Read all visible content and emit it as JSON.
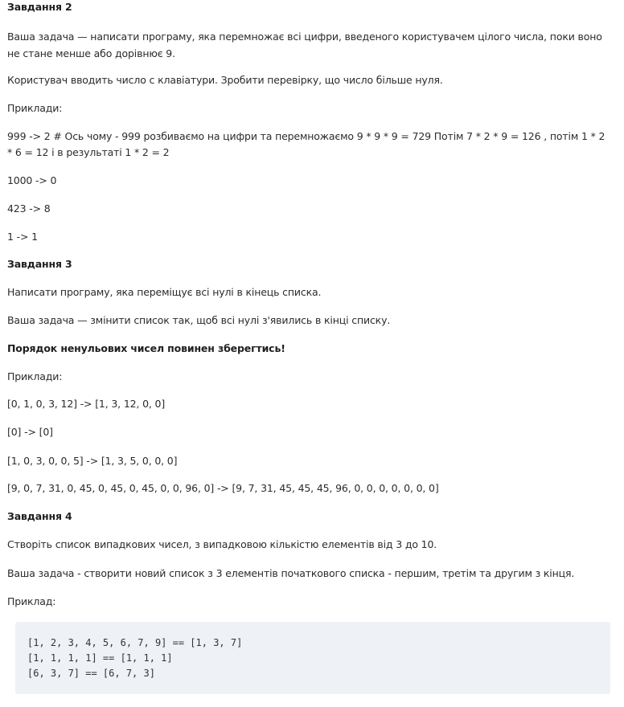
{
  "task2": {
    "heading": "Завдання 2",
    "desc": "Ваша задача — написати програму, яка перемножає всі цифри, введеного користувачем цілого числа, поки воно не стане менше або дорівнює 9.",
    "input_note": "Користувач вводить число с клавіатури. Зробити перевірку, що число більше нуля.",
    "examples_label": "Приклади:",
    "examples": [
      "999 -> 2 # Ось чому - 999 розбиваємо на цифри та перемножаємо 9 * 9 * 9 = 729 Потім 7 * 2 * 9 = 126 , потім 1 * 2 * 6 = 12 і в результаті 1 * 2 = 2",
      "1000 -> 0",
      "423 -> 8",
      "1 -> 1"
    ]
  },
  "task3": {
    "heading": "Завдання 3",
    "desc": "Написати програму, яка переміщує всі нулі в кінець списка.",
    "goal": "Ваша задача — змінити список так, щоб всі нулі з'явились в кінці списку.",
    "note": "Порядок ненульових чисел повинен зберегтись!",
    "examples_label": "Приклади:",
    "examples": [
      "[0, 1, 0, 3, 12] -> [1, 3, 12, 0, 0]",
      "[0] -> [0]",
      "[1, 0, 3, 0, 0, 5] -> [1, 3, 5, 0, 0, 0]",
      "[9, 0, 7, 31, 0, 45, 0, 45, 0, 45, 0, 0, 96, 0] -> [9, 7, 31, 45, 45, 45, 96, 0, 0, 0, 0, 0, 0, 0]"
    ]
  },
  "task4": {
    "heading": "Завдання 4",
    "desc": "Створіть список випадкових чисел, з випадковою кількістю елементів від 3 до 10.",
    "goal": "Ваша задача - створити новий список з 3 елементів початкового списка - першим, третім та другим з кінця.",
    "example_label": "Приклад:",
    "code": [
      "[1, 2, 3, 4, 5, 6, 7, 9] == [1, 3, 7]",
      "[1, 1, 1, 1] == [1, 1, 1]",
      "[6, 3, 7] == [6, 7, 3]"
    ]
  }
}
